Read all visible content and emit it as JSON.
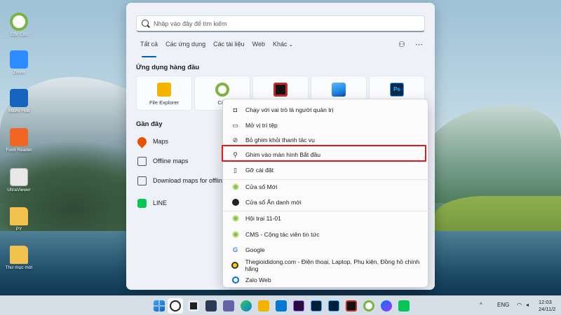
{
  "desktop": {
    "icons": [
      {
        "label": "Cốc Cốc",
        "color": "#7cb342"
      },
      {
        "label": "Zoom",
        "color": "#2d8cff"
      },
      {
        "label": "Mavis Hub",
        "color": "#1565c0"
      },
      {
        "label": "Foxit Reader",
        "color": "#f26522"
      },
      {
        "label": "UltraViewer",
        "color": "#e8e8e8"
      },
      {
        "label": "PY",
        "color": "#f2c14e"
      },
      {
        "label": "Thư mục mới",
        "color": "#f2c14e"
      }
    ]
  },
  "search": {
    "placeholder": "Nhập vào đây để tìm kiếm",
    "tabs": [
      "Tất cả",
      "Các ứng dụng",
      "Các tài liệu",
      "Web",
      "Khác"
    ],
    "active_tab": "Tất cả"
  },
  "top_apps": {
    "title": "Ứng dụng hàng đầu",
    "apps": [
      {
        "label": "File Explorer",
        "color": "#f4b400",
        "icon": "folder-icon"
      },
      {
        "label": "Cốc",
        "color": "#7cb342",
        "icon": "coccoc-icon"
      },
      {
        "label": "",
        "color": "#c62828",
        "icon": "garena-icon"
      },
      {
        "label": "",
        "color": "#1e88e5",
        "icon": "photos-icon"
      },
      {
        "label": "",
        "color": "#0b2a4a",
        "icon": "photoshop-icon"
      }
    ],
    "photoshop_badge": "Ps"
  },
  "recent": {
    "title": "Gần đây",
    "items": [
      {
        "label": "Maps",
        "color": "#e65100",
        "icon": "map-pin-icon"
      },
      {
        "label": "Offline maps",
        "color": "#555555",
        "icon": "offline-map-icon"
      },
      {
        "label": "Download maps for offline",
        "color": "#555555",
        "icon": "download-map-icon"
      },
      {
        "label": "LINE",
        "color": "#06c755",
        "icon": "line-icon"
      }
    ]
  },
  "context_menu": {
    "items": [
      {
        "label": "Chạy với vai trò là người quản trị",
        "icon": "admin-shield-icon"
      },
      {
        "label": "Mở vị trí tệp",
        "icon": "folder-open-icon"
      },
      {
        "label": "Bỏ ghim khỏi thanh tác vụ",
        "icon": "unpin-icon"
      },
      {
        "label": "Ghim vào màn hình Bắt đầu",
        "icon": "pin-icon"
      },
      {
        "label": "Gỡ cài đặt",
        "icon": "trash-icon"
      },
      {
        "label": "Cửa sổ Mới",
        "icon": "coccoc-icon"
      },
      {
        "label": "Cửa sổ Ẩn danh mới",
        "icon": "incognito-icon"
      },
      {
        "label": "Hội trại 11-01",
        "icon": "coccoc-icon"
      },
      {
        "label": "CMS - Cộng tác viên tin tức",
        "icon": "coccoc-icon"
      },
      {
        "label": "Google",
        "icon": "google-icon"
      },
      {
        "label": "Thegioididong.com - Điện thoại, Laptop, Phụ kiện, Đồng hồ chính hãng",
        "icon": "tgdd-icon"
      },
      {
        "label": "Zalo Web",
        "icon": "zalo-icon"
      }
    ],
    "highlight_color": "#e41818"
  },
  "taskbar": {
    "tray_lang": "ENG",
    "tray_up_arrow": "^",
    "clock_time": "12:03",
    "clock_date": "24/11/2"
  }
}
